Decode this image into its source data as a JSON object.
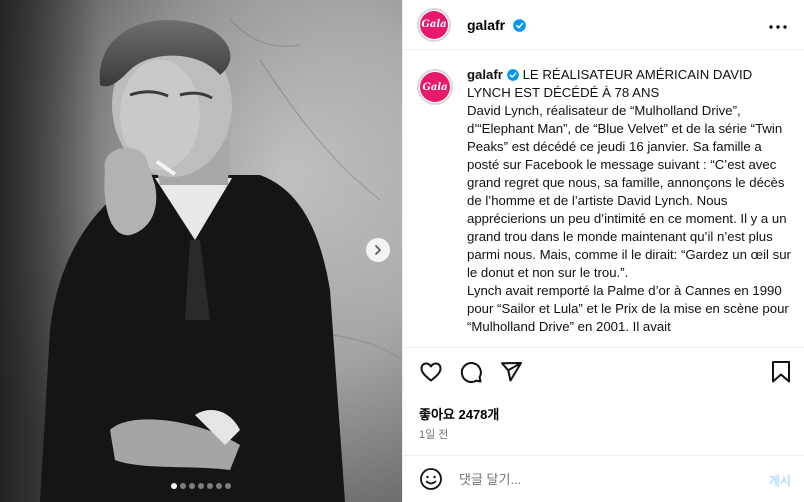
{
  "post": {
    "media": {
      "image_description_icon": "portrait-photo",
      "next_icon": "chevron-right-icon",
      "dot_count": 7,
      "active_dot": 0
    },
    "header": {
      "avatar_text": "Gala",
      "username": "galafr",
      "verified_icon": "verified-badge-icon",
      "more_icon": "more-horizontal-icon"
    },
    "caption": {
      "avatar_text": "Gala",
      "username": "galafr",
      "headline": "LE RÉALISATEUR AMÉRICAIN DAVID LYNCH EST DÉCÉDÉ À 78 ANS",
      "body": "David Lynch, réalisateur de “Mulholland Drive”, d’“Elephant Man”, de “Blue Velvet” et de la série “Twin Peaks” est décédé ce jeudi 16 janvier. Sa famille a posté sur Facebook le message suivant : “C’est avec grand regret que nous, sa famille, annonçons le décès de l’homme et de l’artiste David Lynch. Nous apprécierions un peu d’intimité en ce moment. Il y a un grand trou dans le monde maintenant qu’il n’est plus parmi nous. Mais, comme il le dirait: “Gardez un œil sur le donut et non sur le trou.”.",
      "body2": "Lynch avait remporté la Palme d’or à Cannes en 1990 pour “Sailor et Lula” et le Prix de la mise en scène pour “Mulholland Drive” en 2001. Il avait"
    },
    "actions": {
      "like_icon": "heart-icon",
      "comment_icon": "comment-icon",
      "share_icon": "share-icon",
      "save_icon": "bookmark-icon"
    },
    "likes_text": "좋아요 2478개",
    "time_text": "1일 전",
    "comment": {
      "emoji_icon": "emoji-icon",
      "placeholder": "댓글 달기...",
      "post_label": "게시"
    },
    "colors": {
      "brand": "#e8196b",
      "verified": "#0095f6",
      "post_disabled": "#b3dbff"
    }
  }
}
